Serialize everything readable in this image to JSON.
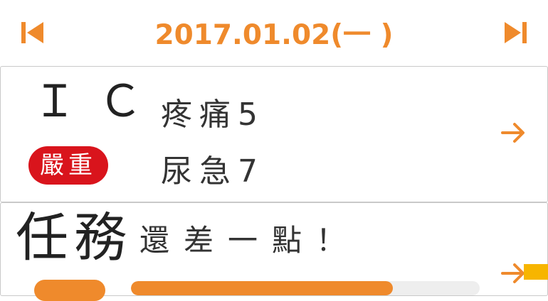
{
  "header": {
    "date": "2017.01.02(一 )"
  },
  "ic_card": {
    "title": "ＩＣ",
    "severity": "嚴重",
    "symptoms": [
      {
        "label": "疼痛",
        "value": "5"
      },
      {
        "label": "尿急",
        "value": "7"
      }
    ]
  },
  "task_card": {
    "title": "任務",
    "message": "還差一點！",
    "progress": 0.75
  },
  "colors": {
    "accent": "#ef8a2c",
    "severe": "#d9141c",
    "tab": "#f7b500"
  },
  "icons": {
    "prev": "skip-previous-icon",
    "next": "skip-next-icon",
    "arrow": "arrow-right-icon"
  }
}
